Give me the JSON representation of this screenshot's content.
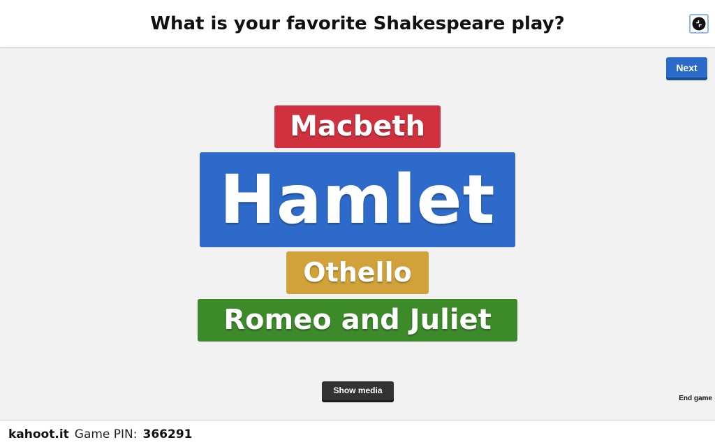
{
  "header": {
    "question": "What is your favorite Shakespeare play?",
    "collapse_icon": "collapse-arrows-icon"
  },
  "controls": {
    "next_label": "Next",
    "next_color": "#2a6ac9",
    "show_media_label": "Show media",
    "end_game_label": "End game"
  },
  "word_cloud": {
    "words": [
      {
        "text": "Macbeth",
        "color": "#d0313f"
      },
      {
        "text": "Hamlet",
        "color": "#2d6ac9"
      },
      {
        "text": "Othello",
        "color": "#d1a23a"
      },
      {
        "text": "Romeo and Juliet",
        "color": "#3c8a2a"
      }
    ]
  },
  "footer": {
    "site": "kahoot.it",
    "pin_label": "Game PIN:",
    "pin_value": "366291"
  }
}
